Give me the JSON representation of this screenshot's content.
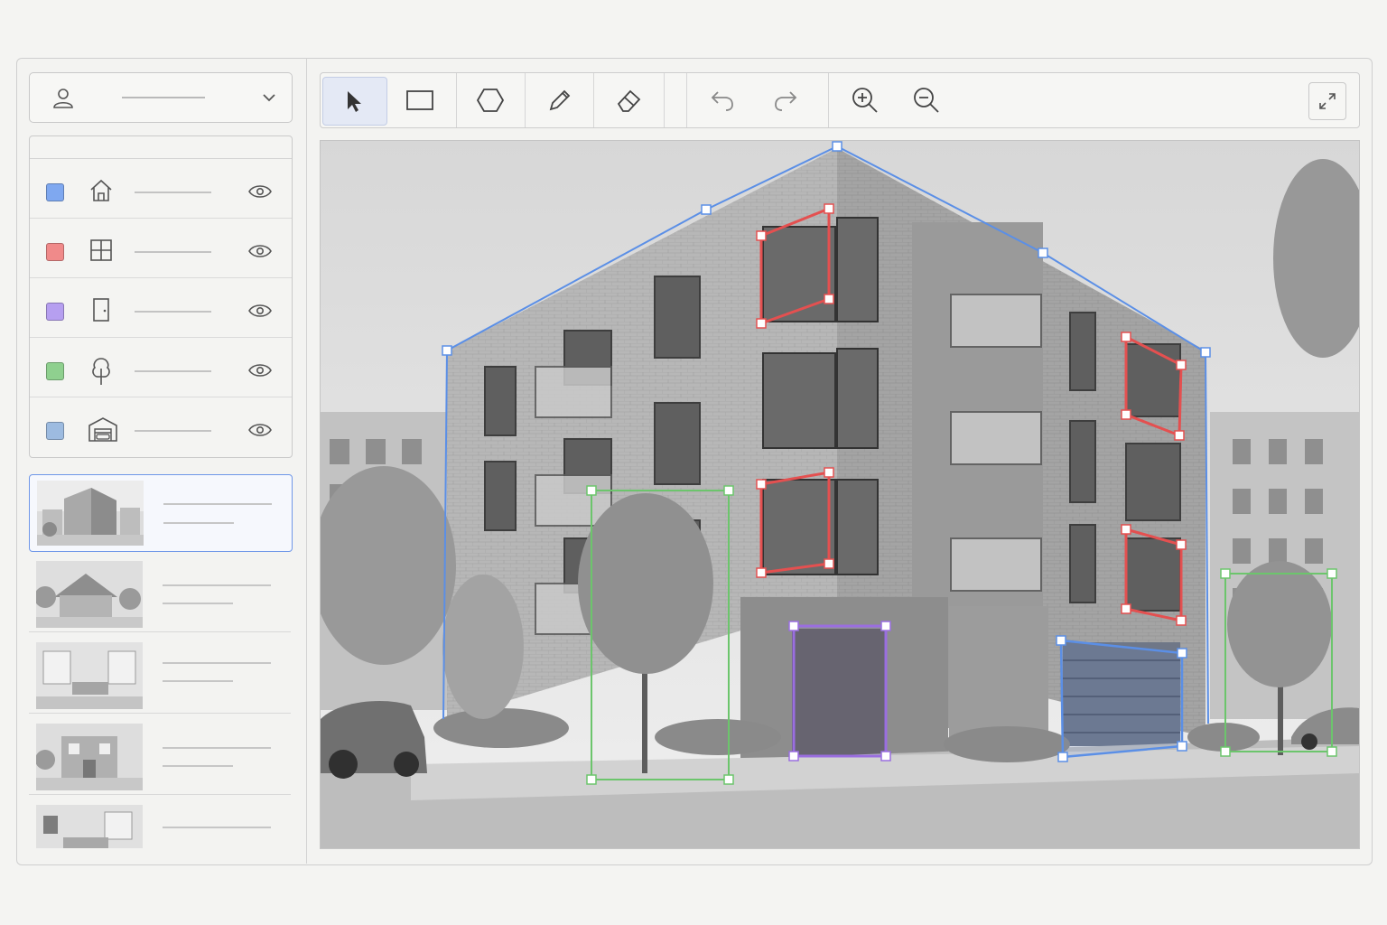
{
  "user": {
    "name": "",
    "dropdown_icon": "chevron-down-icon",
    "avatar_icon": "user-icon"
  },
  "layers": [
    {
      "color": "#7fa8f0",
      "icon": "house-icon",
      "label": ""
    },
    {
      "color": "#f08a8a",
      "icon": "window-icon",
      "label": ""
    },
    {
      "color": "#b69ff0",
      "icon": "door-icon",
      "label": ""
    },
    {
      "color": "#8fd08f",
      "icon": "tree-icon",
      "label": ""
    },
    {
      "color": "#9dbbe0",
      "icon": "garage-icon",
      "label": ""
    }
  ],
  "toolbar": {
    "tools": [
      "select-tool",
      "rectangle-tool",
      "polygon-tool",
      "pencil-tool",
      "eraser-tool",
      "undo",
      "redo",
      "zoom-in",
      "zoom-out"
    ],
    "active_tool": "select-tool"
  },
  "annotation_colors": {
    "building": "#5b8fe6",
    "window": "#e45050",
    "door": "#9a6ee0",
    "tree": "#6cc56c",
    "garage": "#5b8fe6"
  }
}
